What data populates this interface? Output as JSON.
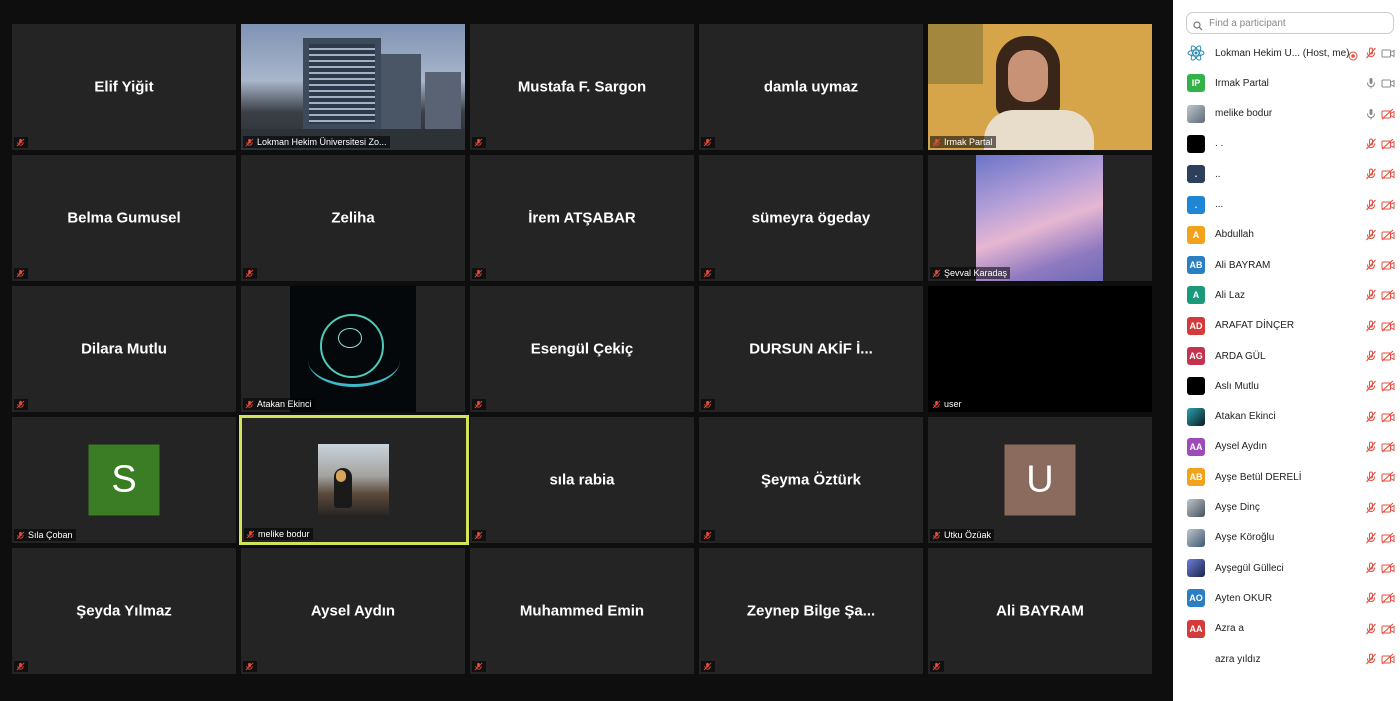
{
  "tiles": [
    {
      "big": "Elif Yiğit"
    },
    {
      "tag": "Lokman Hekim Üniversitesi Zo...",
      "video": "building"
    },
    {
      "big": "Mustafa F. Sargon"
    },
    {
      "big": "damla uymaz"
    },
    {
      "tag": "Irmak Partal",
      "video": "person"
    },
    {
      "big": "Belma Gumusel"
    },
    {
      "big": "Zeliha"
    },
    {
      "big": "İrem ATŞABAR"
    },
    {
      "big": "sümeyra ögeday"
    },
    {
      "tag": "Şevval Karadaş",
      "video": "sky"
    },
    {
      "big": "Dilara Mutlu"
    },
    {
      "tag": "Atakan Ekinci",
      "video": "astronaut"
    },
    {
      "big": "Esengül Çekiç"
    },
    {
      "big": "DURSUN AKİF İ..."
    },
    {
      "tag": "user",
      "video": "black"
    },
    {
      "tag": "Sıla Çoban",
      "avatar": "S",
      "avatar_color": "#3a7d24"
    },
    {
      "tag": "melike bodur",
      "video": "sunset",
      "active": true
    },
    {
      "big": "sıla rabia"
    },
    {
      "big": "Şeyma Öztürk"
    },
    {
      "tag": "Utku Özüak",
      "avatar": "U",
      "avatar_color": "#8a6b5e"
    },
    {
      "big": "Şeyda Yılmaz"
    },
    {
      "big": "Aysel Aydın"
    },
    {
      "big": "Muhammed Emin"
    },
    {
      "big": "Zeynep Bilge Şa..."
    },
    {
      "big": "Ali BAYRAM"
    }
  ],
  "panel": {
    "search_placeholder": "Find a participant",
    "participants": [
      {
        "name": "Lokman Hekim U... (Host, me)",
        "initials": "",
        "color": "#ffffff",
        "icon": "atom",
        "mic": "off",
        "cam": "on",
        "host": true
      },
      {
        "name": "Irmak Partal",
        "initials": "IP",
        "color": "#35b14a",
        "mic": "on",
        "cam": "on"
      },
      {
        "name": "melike bodur",
        "initials": "",
        "color": "#5d6a78",
        "icon": "photo",
        "mic": "on",
        "cam": "off"
      },
      {
        "name": ". .",
        "initials": "",
        "color": "#000000",
        "mic": "off",
        "cam": "off"
      },
      {
        "name": "..",
        "initials": ".",
        "color": "#2d3f5a",
        "mic": "off",
        "cam": "off"
      },
      {
        "name": "...",
        "initials": ".",
        "color": "#1f86d6",
        "mic": "off",
        "cam": "off"
      },
      {
        "name": "Abdullah",
        "initials": "A",
        "color": "#f2a31b",
        "mic": "off",
        "cam": "off"
      },
      {
        "name": "Ali BAYRAM",
        "initials": "AB",
        "color": "#2a7ec2",
        "mic": "off",
        "cam": "off"
      },
      {
        "name": "Ali Laz",
        "initials": "A",
        "color": "#1a9a7a",
        "mic": "off",
        "cam": "off"
      },
      {
        "name": "ARAFAT DİNÇER",
        "initials": "AD",
        "color": "#d33a3a",
        "mic": "off",
        "cam": "off"
      },
      {
        "name": "ARDA GÜL",
        "initials": "AG",
        "color": "#c2334d",
        "mic": "off",
        "cam": "off"
      },
      {
        "name": "Aslı Mutlu",
        "initials": "",
        "color": "#000000",
        "mic": "off",
        "cam": "off"
      },
      {
        "name": "Atakan Ekinci",
        "initials": "",
        "color": "#0c1a20",
        "icon": "photo-dark",
        "mic": "off",
        "cam": "off"
      },
      {
        "name": "Aysel Aydın",
        "initials": "AA",
        "color": "#9c4bb8",
        "mic": "off",
        "cam": "off"
      },
      {
        "name": "Ayşe Betül DERELİ",
        "initials": "AB",
        "color": "#f2a31b",
        "mic": "off",
        "cam": "off"
      },
      {
        "name": "Ayşe Dinç",
        "initials": "",
        "color": "#44505a",
        "icon": "photo",
        "mic": "off",
        "cam": "off"
      },
      {
        "name": "Ayşe Köroğlu",
        "initials": "",
        "color": "#3b5872",
        "icon": "photo",
        "mic": "off",
        "cam": "off"
      },
      {
        "name": "Ayşegül Gülleci",
        "initials": "",
        "color": "#1a2448",
        "icon": "photo-blue",
        "mic": "off",
        "cam": "off"
      },
      {
        "name": "Ayten OKUR",
        "initials": "AO",
        "color": "#2a7ec2",
        "mic": "off",
        "cam": "off"
      },
      {
        "name": "Azra a",
        "initials": "AA",
        "color": "#d33a3a",
        "mic": "off",
        "cam": "off"
      },
      {
        "name": "azra yıldız",
        "initials": "",
        "color": "#ffffff",
        "mic": "off",
        "cam": "off"
      }
    ]
  }
}
